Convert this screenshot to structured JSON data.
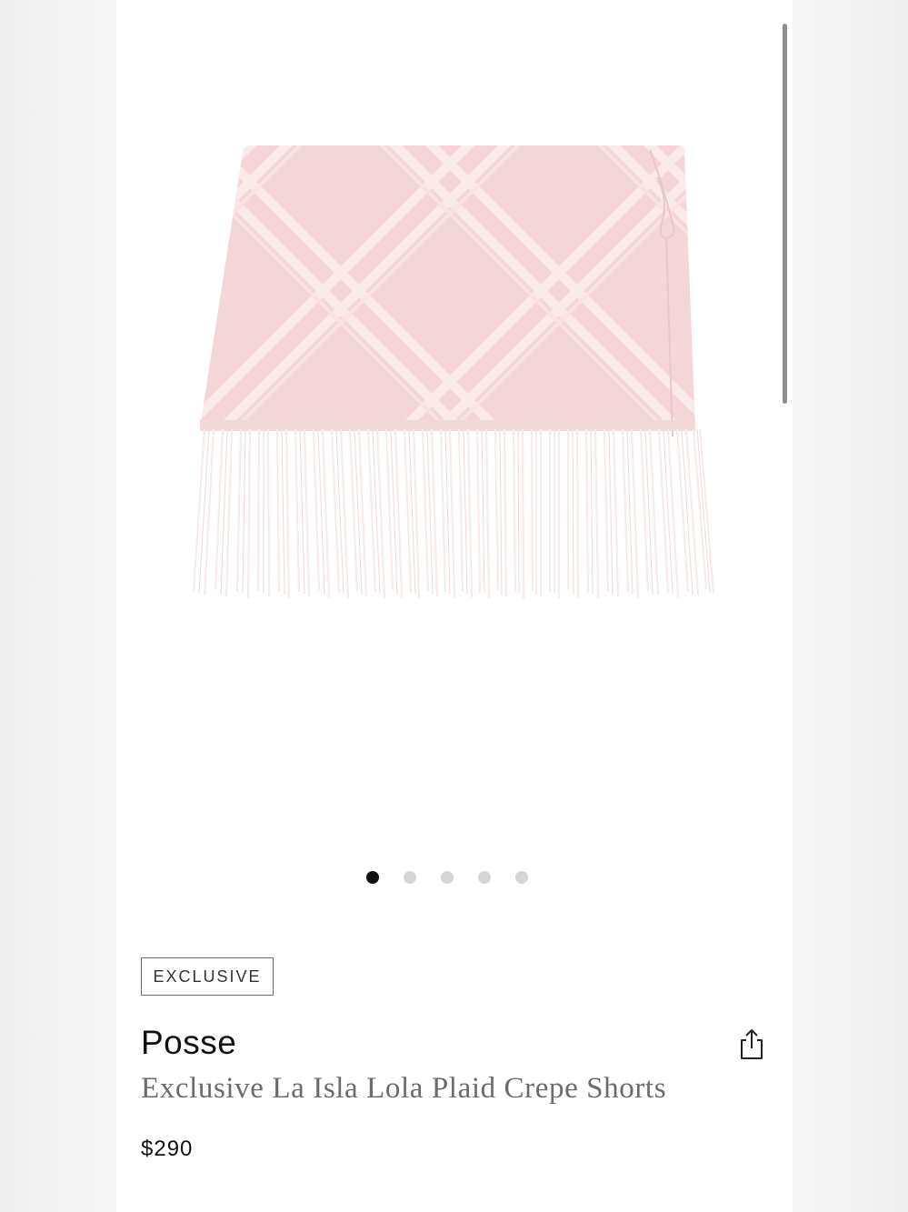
{
  "carousel": {
    "image_icon": "fringe-plaid-shorts-image",
    "dot_count": 5,
    "active_index": 0
  },
  "product": {
    "badge": "EXCLUSIVE",
    "brand": "Posse",
    "name": "Exclusive La Isla Lola Plaid Crepe Shorts",
    "price": "$290"
  },
  "actions": {
    "share_icon": "share-icon"
  },
  "colors": {
    "fabric": "#f4d6d8",
    "fringe": "#f5e6e4",
    "dot_active": "#111111",
    "dot_inactive": "#d6d6d6"
  }
}
